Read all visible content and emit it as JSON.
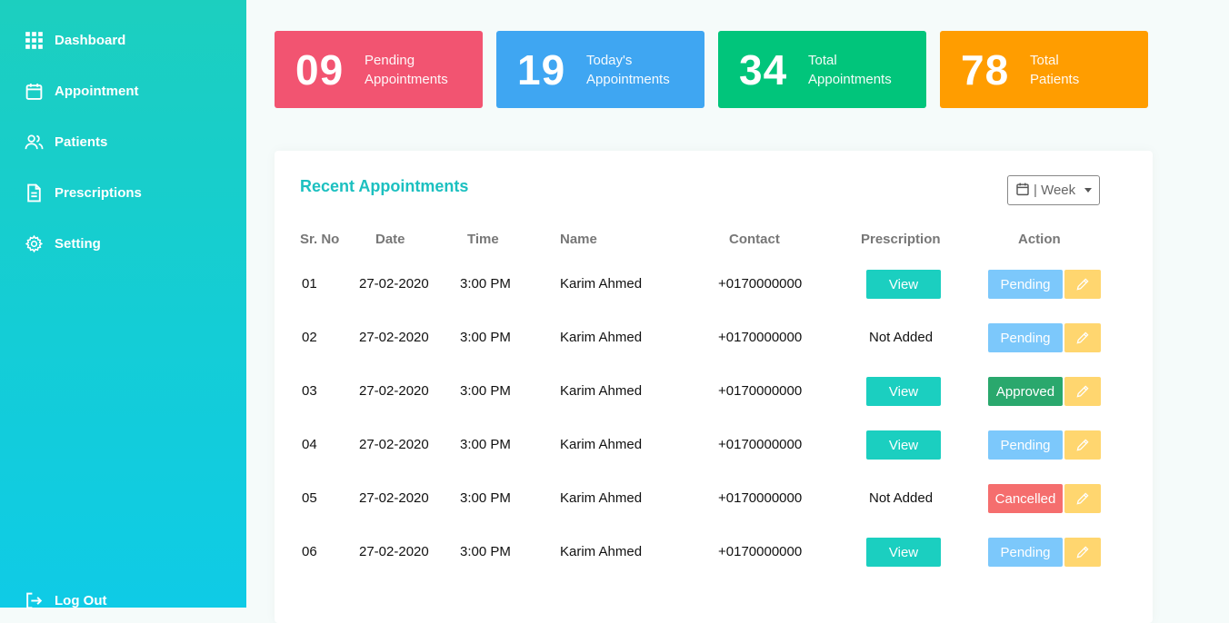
{
  "sidebar": {
    "items": [
      {
        "label": "Dashboard",
        "icon": "grid-icon"
      },
      {
        "label": "Appointment",
        "icon": "calendar-icon"
      },
      {
        "label": "Patients",
        "icon": "users-icon"
      },
      {
        "label": "Prescriptions",
        "icon": "document-icon"
      },
      {
        "label": "Setting",
        "icon": "gear-icon"
      }
    ],
    "logout_label": "Log Out"
  },
  "cards": [
    {
      "number": "09",
      "line1": "Pending",
      "line2": "Appointments",
      "color": "#f25471"
    },
    {
      "number": "19",
      "line1": "Today's",
      "line2": "Appointments",
      "color": "#3fa6f2"
    },
    {
      "number": "34",
      "line1": "Total",
      "line2": "Appointments",
      "color": "#01c57b"
    },
    {
      "number": "78",
      "line1": "Total",
      "line2": "Patients",
      "color": "#ff9d00"
    }
  ],
  "recent": {
    "title": "Recent Appointments",
    "filter_label": "| Week",
    "columns": [
      "Sr. No",
      "Date",
      "Time",
      "Name",
      "Contact",
      "Prescription",
      "Action"
    ],
    "rows": [
      {
        "sr": "01",
        "date": "27-02-2020",
        "time": "3:00 PM",
        "name": "Karim Ahmed",
        "contact": "+0170000000",
        "prescription": "View",
        "status": "Pending"
      },
      {
        "sr": "02",
        "date": "27-02-2020",
        "time": "3:00 PM",
        "name": "Karim Ahmed",
        "contact": "+0170000000",
        "prescription": "Not Added",
        "status": "Pending"
      },
      {
        "sr": "03",
        "date": "27-02-2020",
        "time": "3:00 PM",
        "name": "Karim Ahmed",
        "contact": "+0170000000",
        "prescription": "View",
        "status": "Approved"
      },
      {
        "sr": "04",
        "date": "27-02-2020",
        "time": "3:00 PM",
        "name": "Karim Ahmed",
        "contact": "+0170000000",
        "prescription": "View",
        "status": "Pending"
      },
      {
        "sr": "05",
        "date": "27-02-2020",
        "time": "3:00 PM",
        "name": "Karim Ahmed",
        "contact": "+0170000000",
        "prescription": "Not Added",
        "status": "Cancelled"
      },
      {
        "sr": "06",
        "date": "27-02-2020",
        "time": "3:00 PM",
        "name": "Karim Ahmed",
        "contact": "+0170000000",
        "prescription": "View",
        "status": "Pending"
      }
    ]
  },
  "colors": {
    "accent": "#1bcfc0",
    "pending": "#7cc8fb",
    "approved": "#2aa86d",
    "cancelled": "#f56e6e",
    "edit": "#ffd66f"
  }
}
